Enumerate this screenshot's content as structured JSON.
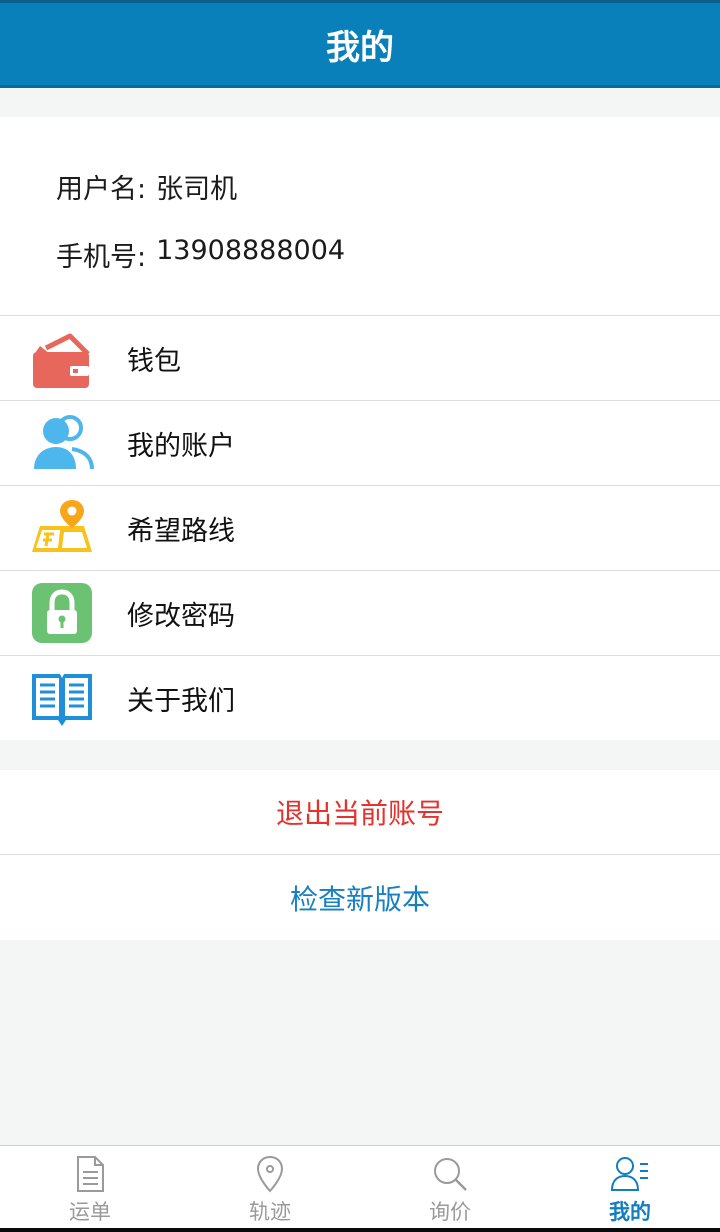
{
  "header": {
    "title": "我的"
  },
  "user": {
    "name_label": "用户名:",
    "name_value": "张司机",
    "phone_label": "手机号:",
    "phone_value": "13908888004"
  },
  "menu": [
    {
      "label": "钱包",
      "icon": "wallet-icon"
    },
    {
      "label": "我的账户",
      "icon": "account-icon"
    },
    {
      "label": "希望路线",
      "icon": "route-map-icon"
    },
    {
      "label": "修改密码",
      "icon": "lock-icon"
    },
    {
      "label": "关于我们",
      "icon": "book-icon"
    }
  ],
  "actions": {
    "logout": "退出当前账号",
    "check_update": "检查新版本"
  },
  "tabs": [
    {
      "label": "运单",
      "icon": "document-icon"
    },
    {
      "label": "轨迹",
      "icon": "location-pin-icon"
    },
    {
      "label": "询价",
      "icon": "search-icon"
    },
    {
      "label": "我的",
      "icon": "profile-icon",
      "active": true
    }
  ],
  "colors": {
    "header_bg": "#0a80ba",
    "logout_text": "#e5322d",
    "update_text": "#1880c2",
    "active_tab": "#127ec0"
  }
}
